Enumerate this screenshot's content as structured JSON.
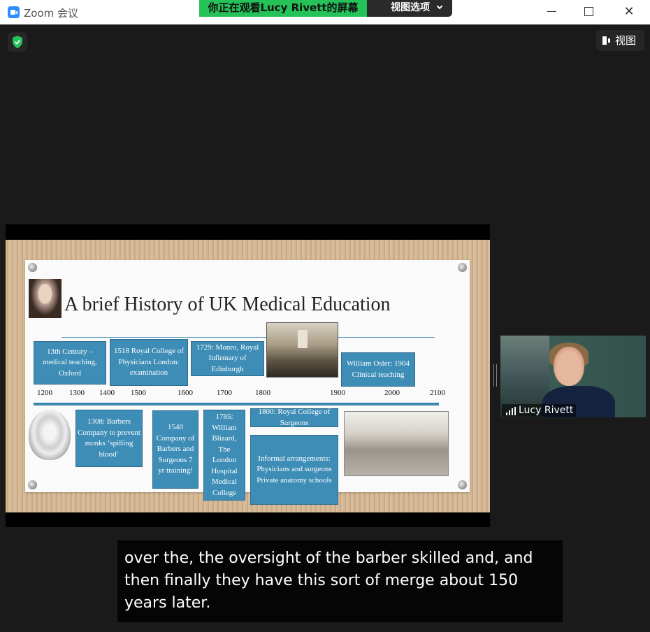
{
  "window": {
    "title": "Zoom 会议",
    "share_banner": "你正在观看Lucy  Rivett的屏幕",
    "view_options_label": "视图选项",
    "close_glyph": "✕"
  },
  "toolbar": {
    "view_label": "视图",
    "security_icon": "shield-check-icon"
  },
  "slide": {
    "title": "A brief History of UK Medical Education",
    "years": [
      "1200",
      "1300",
      "1400",
      "1500",
      "1600",
      "1700",
      "1800",
      "1900",
      "2000",
      "2100"
    ],
    "boxes": [
      {
        "id": "oxford",
        "text": "13th Century – medical teaching, Oxford"
      },
      {
        "id": "rcp",
        "text": "1518 Royal College of Physicians London: examination"
      },
      {
        "id": "monro",
        "text": "1729: Monro, Royal Infirmary of Edinburgh"
      },
      {
        "id": "osler",
        "text": "William Osler: 1904 Clinical teaching"
      },
      {
        "id": "barbers1308",
        "text": "1308: Barbers Company to prevent monks ‘spilling blood’"
      },
      {
        "id": "barbers1540",
        "text": "1540 Company of Barbers and Surgeons 7 yr training!"
      },
      {
        "id": "blizard",
        "text": "1785: William Blizard, The London Hospital Medical College"
      },
      {
        "id": "rcs",
        "text": "1800: Royal College of Surgeons"
      },
      {
        "id": "informal",
        "text": "Informal arrangements: Physicians and surgeons Private anatomy schools"
      }
    ]
  },
  "participant": {
    "name": "Lucy Rivett"
  },
  "caption": {
    "text": "over the, the oversight of the barber skilled and, and then finally they have this sort of merge about 150 years later."
  },
  "colors": {
    "accent_blue": "#3d8db6",
    "share_green": "#25c159",
    "zoom_blue": "#2d8cff"
  }
}
